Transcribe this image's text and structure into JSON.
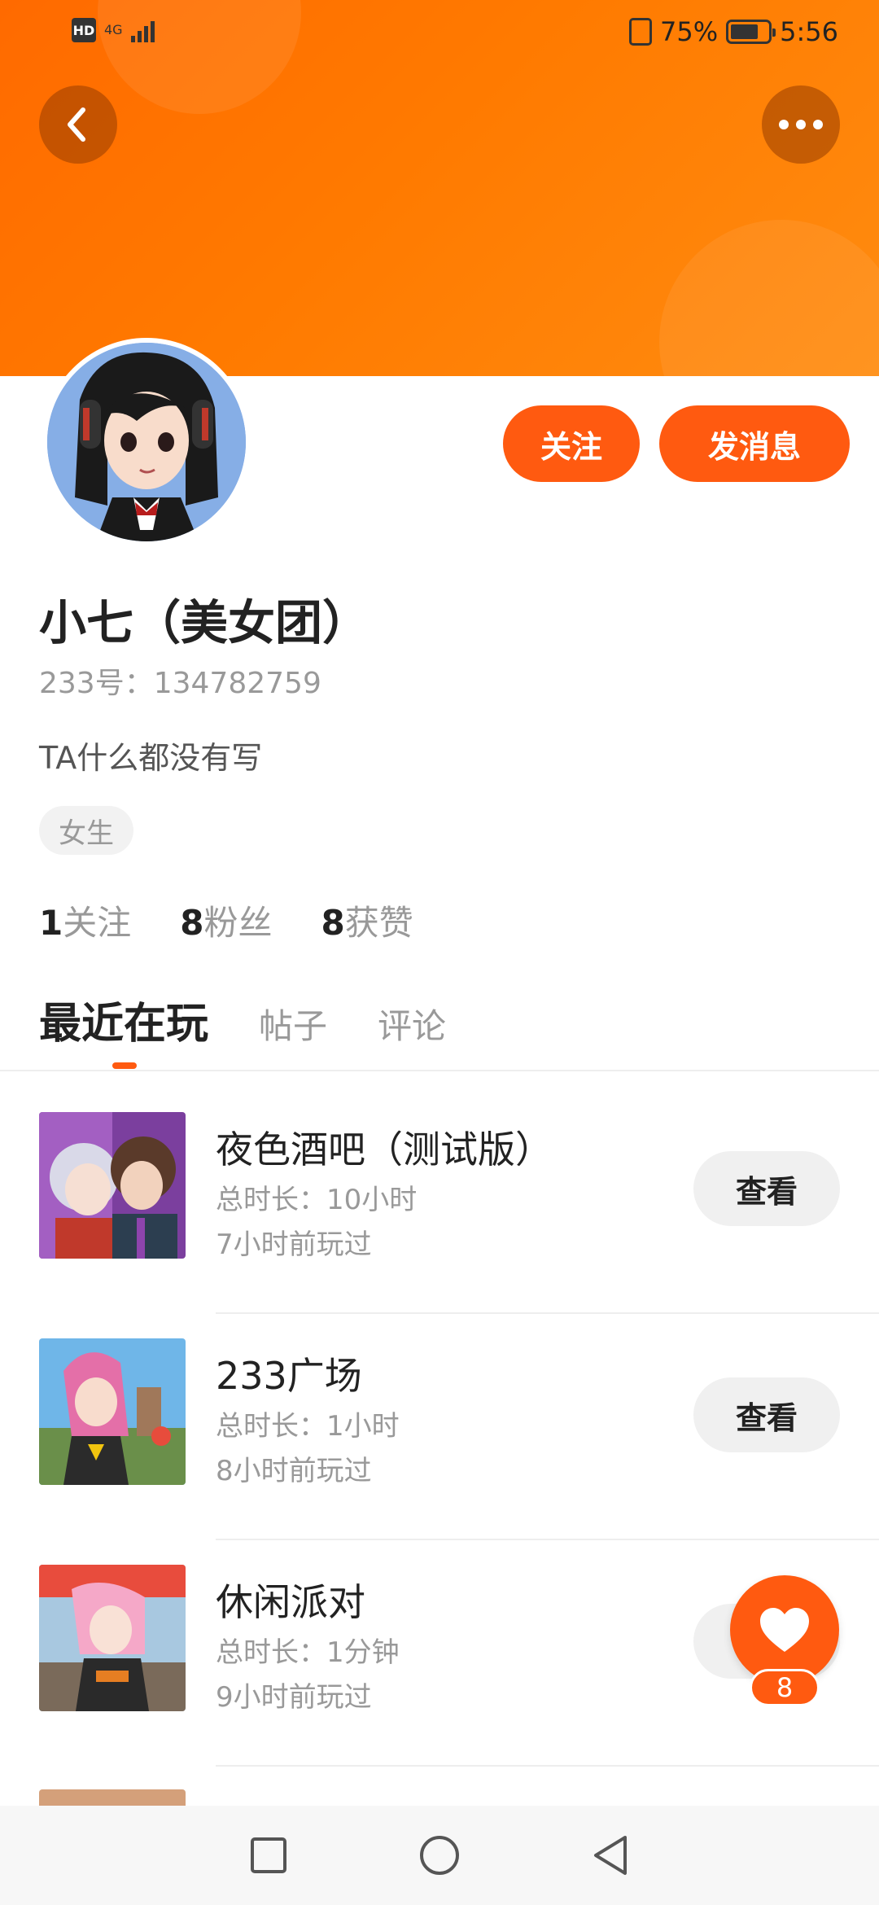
{
  "status_bar": {
    "hd_label": "HD",
    "network_label": "4G",
    "battery": "75%",
    "time": "5:56"
  },
  "header": {
    "back_icon": "chevron-left-icon",
    "more_icon": "more-dots-icon"
  },
  "profile": {
    "name": "小七（美女团）",
    "account_id": "233号：134782759",
    "bio": "TA什么都没有写",
    "gender_tag": "女生",
    "follow_label": "关注",
    "message_label": "发消息"
  },
  "stats": [
    {
      "value": "1",
      "label": "关注"
    },
    {
      "value": "8",
      "label": "粉丝"
    },
    {
      "value": "8",
      "label": "获赞"
    }
  ],
  "tabs": [
    {
      "label": "最近在玩",
      "active": true
    },
    {
      "label": "帖子",
      "active": false
    },
    {
      "label": "评论",
      "active": false
    }
  ],
  "games": [
    {
      "title": "夜色酒吧（测试版）",
      "duration": "总时长：10小时",
      "last_played": "7小时前玩过",
      "button": "查看"
    },
    {
      "title": "233广场",
      "duration": "总时长：1小时",
      "last_played": "8小时前玩过",
      "button": "查看"
    },
    {
      "title": "休闲派对",
      "duration": "总时长：1分钟",
      "last_played": "9小时前玩过",
      "button": "查看"
    }
  ],
  "like_fab": {
    "icon": "heart-icon",
    "count": "8"
  },
  "colors": {
    "accent": "#ff5a10",
    "header_gradient_start": "#ff6a00",
    "header_gradient_end": "#ff8c10"
  },
  "nav": {
    "recent_icon": "square-icon",
    "home_icon": "circle-icon",
    "back_icon": "triangle-back-icon"
  }
}
